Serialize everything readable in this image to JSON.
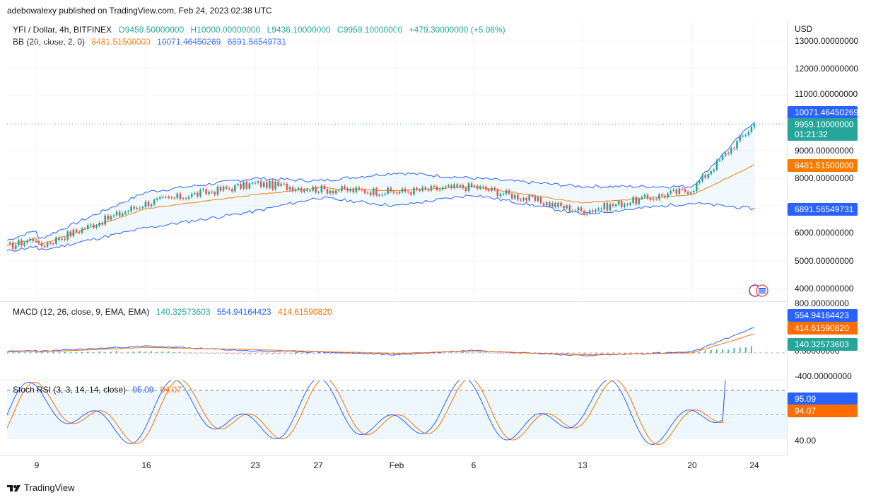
{
  "header": {
    "published": "adebowalexy published on TradingView.com, Feb 24, 2023 02:38 UTC"
  },
  "main_legend": {
    "symbol": "YFI / Dollar, 4h, BITFINEX",
    "open": "O9459.50000000",
    "high": "H10000.00000000",
    "low": "L9436.10000000",
    "close": "C9959.10000000",
    "change": "+479.30000000 (+5.06%)"
  },
  "bb_legend": {
    "label": "BB (20, close, 2, 0)",
    "basis": "8481.51500000",
    "upper": "10071.46450269",
    "lower": "6891.56549731"
  },
  "price_axis": {
    "currency": "USD",
    "ticks": [
      "13000.00000000",
      "12000.00000000",
      "11000.00000000",
      "9000.00000000",
      "8000.00000000",
      "6000.00000000",
      "5000.00000000",
      "4000.00000000"
    ]
  },
  "price_tags": {
    "upper_band": "10071.46450269",
    "last_price": "9959.10000000",
    "countdown": "01:21:32",
    "basis": "8481.51500000",
    "lower_band": "6891.56549731"
  },
  "macd_legend": {
    "label": "MACD (12, 26, close, 9, EMA, EMA)",
    "histogram": "140.32573603",
    "macd": "554.94164423",
    "signal": "414.61590820"
  },
  "macd_axis": {
    "ticks": [
      "800.00000000",
      "0.00000000",
      "-400.00000000"
    ]
  },
  "stoch_legend": {
    "label": "Stoch RSI (3, 3, 14, 14, close)",
    "k": "95.09",
    "d": "94.07"
  },
  "stoch_axis": {
    "ticks": [
      "40.00"
    ]
  },
  "time_axis": {
    "labels": [
      "9",
      "16",
      "23",
      "27",
      "Feb",
      "6",
      "13",
      "20",
      "24"
    ]
  },
  "footer": {
    "brand": "TradingView"
  },
  "colors": {
    "up": "#26a69a",
    "down": "#ef5350",
    "bb_band": "#2962ff",
    "bb_basis": "#f57c00",
    "macd_line": "#2962ff",
    "signal_line": "#ff6d00",
    "stoch_k": "#2962ff",
    "stoch_d": "#ff6d00"
  },
  "chart_data": {
    "type": "line",
    "x": [
      "9",
      "16",
      "23",
      "27",
      "Feb",
      "6",
      "13",
      "20",
      "24"
    ],
    "series": [
      {
        "name": "close",
        "values": [
          5500,
          7100,
          7800,
          7600,
          7500,
          7700,
          6800,
          7600,
          9959
        ]
      },
      {
        "name": "BB basis",
        "values": [
          5550,
          6900,
          7400,
          7650,
          7550,
          7700,
          7100,
          7400,
          8481
        ]
      },
      {
        "name": "BB upper",
        "values": [
          5750,
          7500,
          8000,
          7900,
          8200,
          8000,
          7700,
          7700,
          10071
        ]
      },
      {
        "name": "BB lower",
        "values": [
          5350,
          6200,
          6800,
          7300,
          7000,
          7400,
          6700,
          7100,
          6891
        ]
      }
    ],
    "ylim": [
      4000,
      13000
    ]
  }
}
